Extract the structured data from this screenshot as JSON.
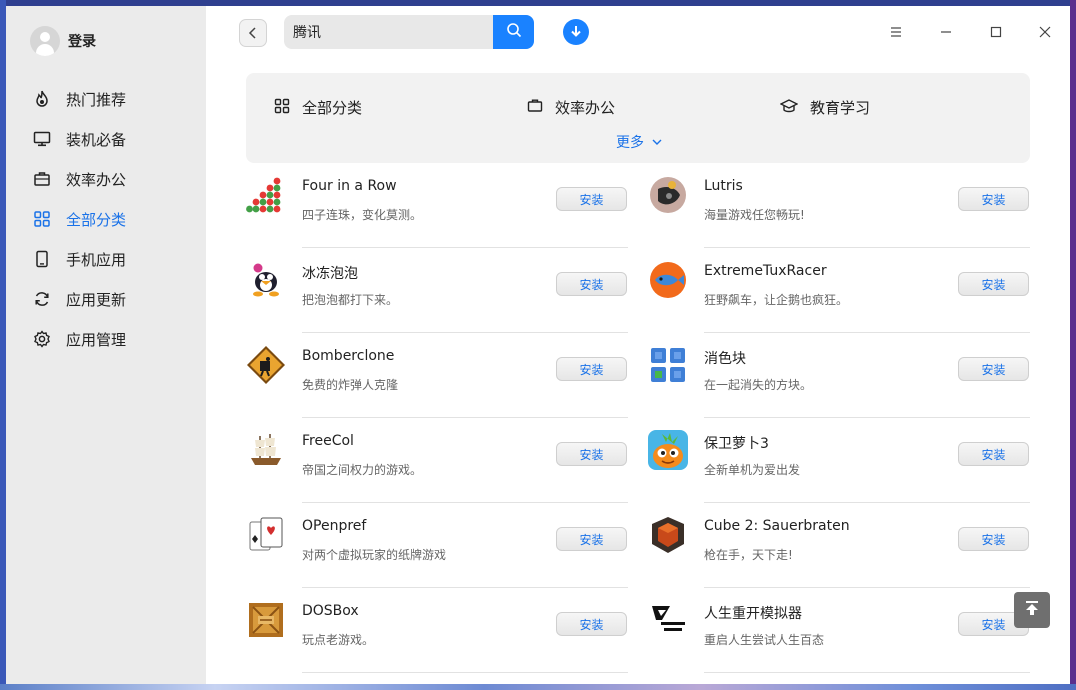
{
  "sidebar": {
    "login_label": "登录",
    "items": [
      {
        "label": "热门推荐",
        "icon": "flame-icon"
      },
      {
        "label": "装机必备",
        "icon": "monitor-icon"
      },
      {
        "label": "效率办公",
        "icon": "briefcase-icon"
      },
      {
        "label": "全部分类",
        "icon": "grid-icon",
        "active": true
      },
      {
        "label": "手机应用",
        "icon": "phone-icon"
      },
      {
        "label": "应用更新",
        "icon": "refresh-icon"
      },
      {
        "label": "应用管理",
        "icon": "gear-icon"
      }
    ]
  },
  "header": {
    "search_value": "腾讯"
  },
  "categories": {
    "items": [
      {
        "label": "全部分类",
        "icon": "grid-icon"
      },
      {
        "label": "效率办公",
        "icon": "briefcase-icon"
      },
      {
        "label": "教育学习",
        "icon": "graduation-cap-icon"
      }
    ],
    "more_label": "更多"
  },
  "apps": [
    {
      "name": "Four in a Row",
      "desc": "四子连珠，变化莫测。",
      "install": "安装"
    },
    {
      "name": "Lutris",
      "desc": "海量游戏任您畅玩!",
      "install": "安装"
    },
    {
      "name": "冰冻泡泡",
      "desc": "把泡泡都打下来。",
      "install": "安装"
    },
    {
      "name": "ExtremeTuxRacer",
      "desc": "狂野飙车，让企鹅也疯狂。",
      "install": "安装"
    },
    {
      "name": "Bomberclone",
      "desc": "免费的炸弹人克隆",
      "install": "安装"
    },
    {
      "name": "消色块",
      "desc": "在一起消失的方块。",
      "install": "安装"
    },
    {
      "name": "FreeCol",
      "desc": "帝国之间权力的游戏。",
      "install": "安装"
    },
    {
      "name": "保卫萝卜3",
      "desc": "全新单机为爱出发",
      "install": "安装"
    },
    {
      "name": "OPenpref",
      "desc": "对两个虚拟玩家的纸牌游戏",
      "install": "安装"
    },
    {
      "name": "Cube 2: Sauerbraten",
      "desc": "枪在手，天下走!",
      "install": "安装"
    },
    {
      "name": "DOSBox",
      "desc": "玩点老游戏。",
      "install": "安装"
    },
    {
      "name": "人生重开模拟器",
      "desc": "重启人生尝试人生百态",
      "install": "安装"
    }
  ],
  "colors": {
    "accent": "#1a82ff",
    "sidebar_bg": "#ebebeb",
    "active_text": "#1a72e8"
  }
}
